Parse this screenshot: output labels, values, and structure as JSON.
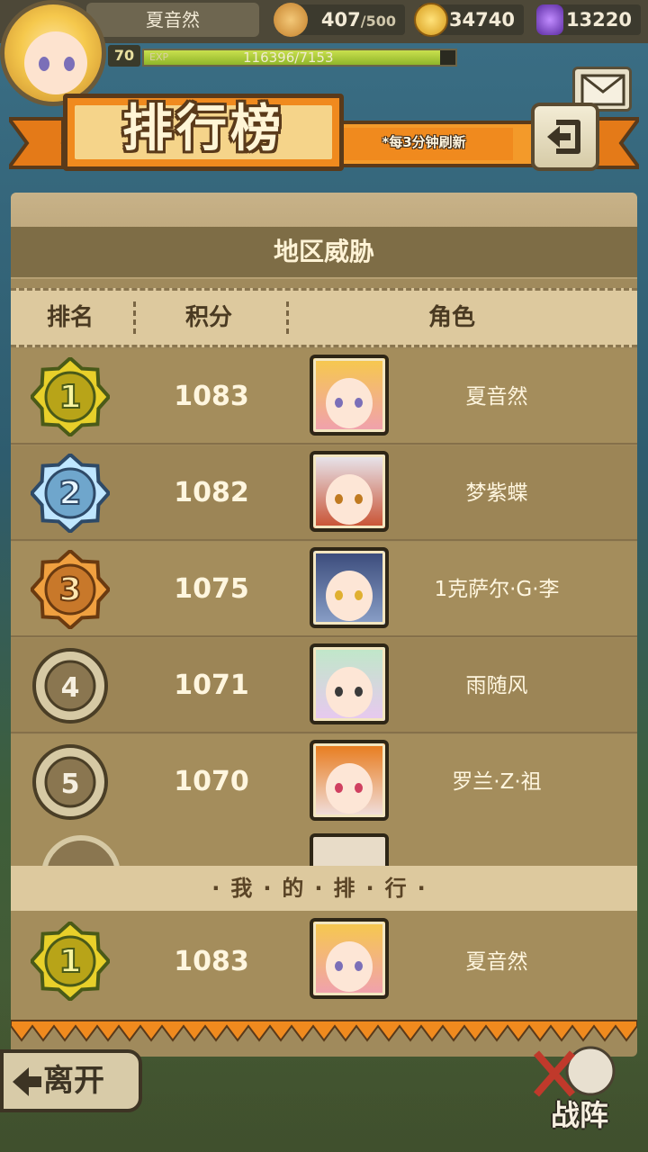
{
  "header": {
    "player_name": "夏音然",
    "stamina": "407",
    "stamina_max": "/500",
    "gold": "34740",
    "gems": "13220",
    "level": "70",
    "exp_label": "EXP",
    "exp_text": "116396/7153",
    "exp_fraction": 0.95
  },
  "banner": {
    "title": "排行榜",
    "refresh_note": "*每3分钟刷新"
  },
  "panel": {
    "title": "地区威胁",
    "columns": {
      "rank": "排名",
      "score": "积分",
      "character": "角色"
    }
  },
  "leaderboard": [
    {
      "rank": "1",
      "score": "1083",
      "name": "夏音然",
      "tier": "gold"
    },
    {
      "rank": "2",
      "score": "1082",
      "name": "梦紫蝶",
      "tier": "silver"
    },
    {
      "rank": "3",
      "score": "1075",
      "name": "1克萨尔·G·李",
      "tier": "bronze"
    },
    {
      "rank": "4",
      "score": "1071",
      "name": "雨随风",
      "tier": "plain"
    },
    {
      "rank": "5",
      "score": "1070",
      "name": "罗兰·Z·祖",
      "tier": "plain"
    }
  ],
  "my_rank": {
    "header": "·我·的·排·行·",
    "rank": "1",
    "score": "1083",
    "name": "夏音然"
  },
  "bottom": {
    "leave": "离开",
    "formation": "战阵"
  },
  "colors": {
    "accent_orange": "#f08a1e",
    "panel_brown": "#a48d5c",
    "gold_medal": "#e8d02a",
    "silver_medal": "#bfe6ff",
    "bronze_medal": "#f0a040"
  }
}
